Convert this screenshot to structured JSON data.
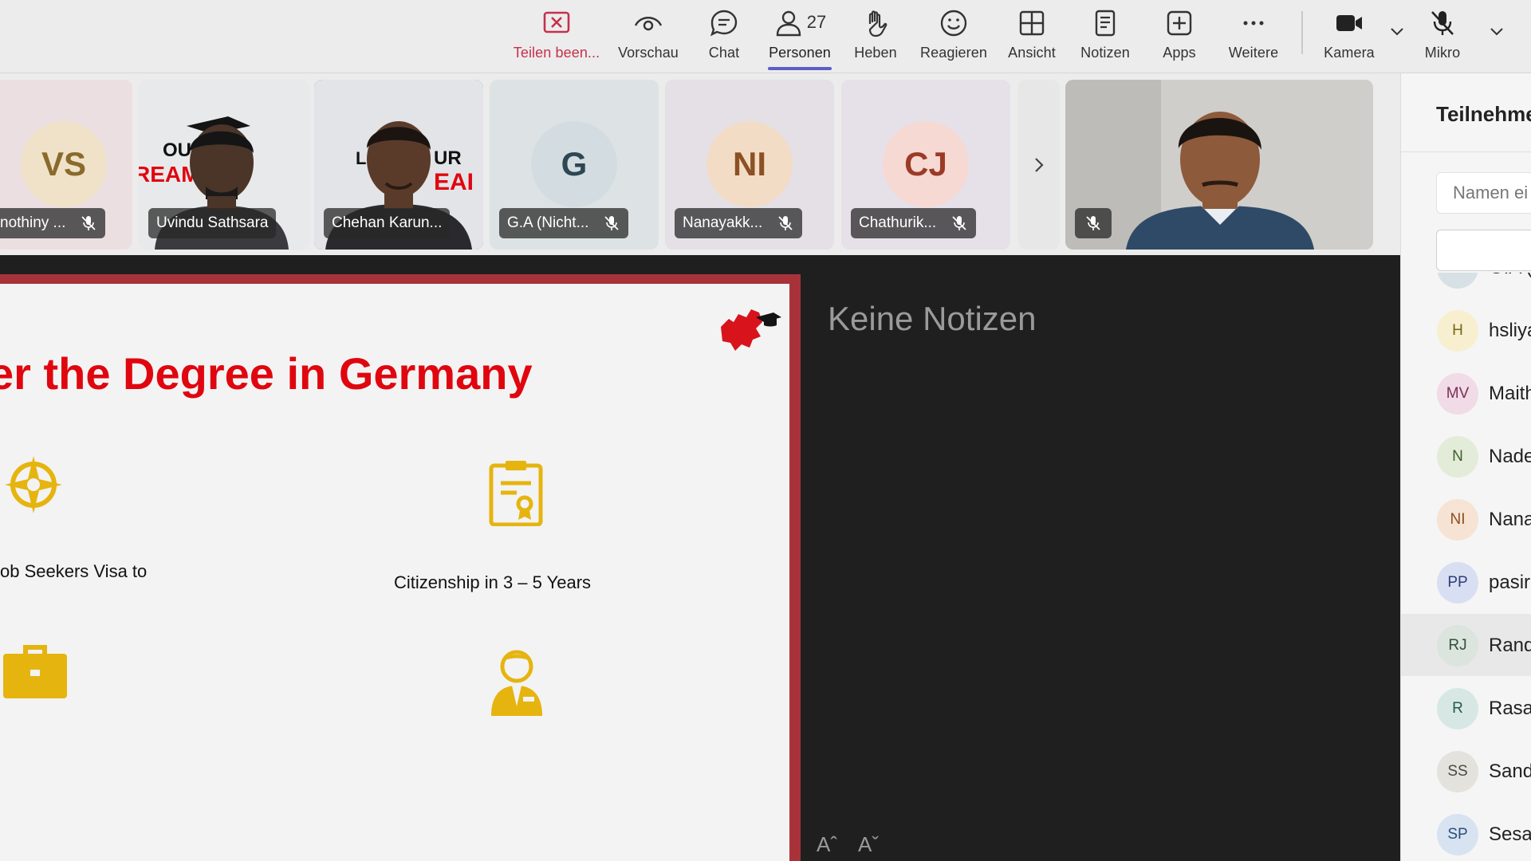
{
  "toolbar": {
    "items": [
      {
        "label": "Teilen been...",
        "icon": "stop-share-icon"
      },
      {
        "label": "Vorschau",
        "icon": "eye-icon"
      },
      {
        "label": "Chat",
        "icon": "chat-icon"
      },
      {
        "label": "Personen",
        "icon": "people-icon",
        "count": "27"
      },
      {
        "label": "Heben",
        "icon": "raise-hand-icon"
      },
      {
        "label": "Reagieren",
        "icon": "smiley-icon"
      },
      {
        "label": "Ansicht",
        "icon": "grid-icon"
      },
      {
        "label": "Notizen",
        "icon": "notes-icon"
      },
      {
        "label": "Apps",
        "icon": "plus-box-icon"
      },
      {
        "label": "Weitere",
        "icon": "more-icon"
      },
      {
        "label": "Kamera",
        "icon": "camera-icon"
      },
      {
        "label": "Mikro",
        "icon": "mic-off-icon"
      }
    ],
    "accent_color": "#5b5fc7",
    "end_color": "#c4314b"
  },
  "strip": {
    "tiles": [
      {
        "initials": "VS",
        "name": "nothiny ...",
        "avatar_bg": "#efe2c8",
        "avatar_fg": "#8a6a2c"
      },
      {
        "initials": "",
        "name": "Uvindu Sathsara",
        "video": true
      },
      {
        "initials": "",
        "name": "Chehan Karun...",
        "video": true,
        "selected": true
      },
      {
        "initials": "G",
        "name": "G.A (Nicht...",
        "avatar_bg": "#d3dce0",
        "avatar_fg": "#2d4753"
      },
      {
        "initials": "NI",
        "name": "Nanayakk...",
        "avatar_bg": "#f3dcc6",
        "avatar_fg": "#8b5023"
      },
      {
        "initials": "CJ",
        "name": "Chathurik...",
        "avatar_bg": "#f6d9d3",
        "avatar_fg": "#9c3a28"
      }
    ]
  },
  "slide": {
    "title": "er the Degree in Germany",
    "text_left": "ob Seekers Visa to",
    "text_right": "Citizenship in 3 – 5 Years",
    "title_color": "#e0060f",
    "icon_color": "#e6b40f"
  },
  "notes": {
    "title": "Keine Notizen",
    "font_up": "Aˆ",
    "font_down": "Aˇ"
  },
  "panel": {
    "title": "Teilnehme",
    "search_placeholder": "Namen ei",
    "participants": [
      {
        "initials": "G",
        "name": "G.A (",
        "bg": "#d7e1e5",
        "fg": "#2d4753"
      },
      {
        "initials": "H",
        "name": "hsliya",
        "bg": "#f7efcf",
        "fg": "#7a6416"
      },
      {
        "initials": "MV",
        "name": "Maith",
        "bg": "#f0dbe6",
        "fg": "#7b2f56"
      },
      {
        "initials": "N",
        "name": "Nade",
        "bg": "#e3ecd9",
        "fg": "#3f5f2a"
      },
      {
        "initials": "NI",
        "name": "Nana",
        "bg": "#f6e3d3",
        "fg": "#8b5023"
      },
      {
        "initials": "PP",
        "name": "pasir",
        "bg": "#d8dff2",
        "fg": "#2b3f7a"
      },
      {
        "initials": "RJ",
        "name": "Rand",
        "bg": "#dbe4dd",
        "fg": "#2f5138"
      },
      {
        "initials": "R",
        "name": "Rasa",
        "bg": "#d7e8e4",
        "fg": "#245a4e"
      },
      {
        "initials": "SS",
        "name": "Sand",
        "bg": "#e3e2dd",
        "fg": "#4a4a40"
      },
      {
        "initials": "SP",
        "name": "Sesa",
        "bg": "#d8e3f2",
        "fg": "#2b4f7a"
      }
    ]
  }
}
